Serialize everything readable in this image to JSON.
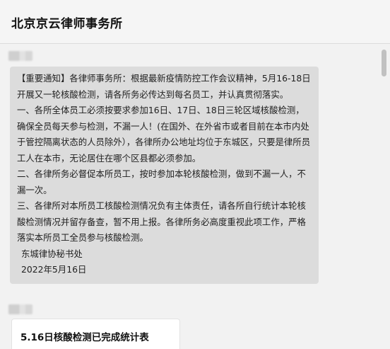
{
  "header": {
    "title": "北京京云律师事务所"
  },
  "messages": [
    {
      "type": "text",
      "paragraphs": [
        "【重要通知】各律师事务所：根据最新疫情防控工作会议精神，5月16-18日开展又一轮核酸检测，请各所务必传达到每名员工，并认真贯彻落实。",
        "一、各所全体员工必须按要求参加16日、17日、18日三轮区域核酸检测，确保全员每天参与检测，不漏一人！(在国外、在外省市或者目前在本市内处于管控隔离状态的人员除外），各律所办公地址均位于东城区，只要是律所员工人在本市，无论居住在哪个区县都必须参加。",
        "二、各律所务必督促本所员工，按时参加本轮核酸检测，做到不漏一人，不漏一次。",
        "三、各律所对本所员工核酸检测情况负有主体责任，请各所自行统计本轮核酸检测情况并留存备查，暂不用上报。各律所务必高度重视此项工作，严格落实本所员工全员参与核酸检测。"
      ],
      "signature": "东城律协秘书处",
      "date": "2022年5月16日"
    },
    {
      "type": "card",
      "title": "5.16日核酸检测已完成统计表"
    }
  ]
}
